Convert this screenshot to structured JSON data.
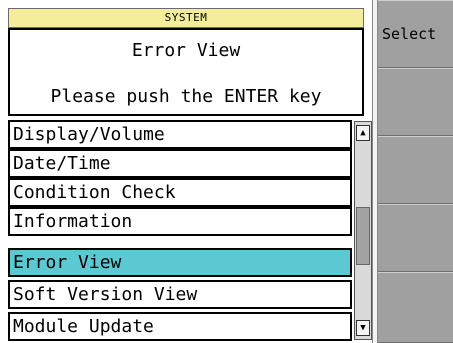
{
  "header": {
    "title": "SYSTEM"
  },
  "message": {
    "heading": "Error View",
    "instruction": "Please push the ENTER key"
  },
  "menu": {
    "items": [
      {
        "label": "Display/Volume",
        "selected": false
      },
      {
        "label": "Date/Time",
        "selected": false
      },
      {
        "label": "Condition Check",
        "selected": false
      },
      {
        "label": "Information",
        "selected": false
      },
      {
        "label": "Error View",
        "selected": true
      },
      {
        "label": "Soft Version View",
        "selected": false
      },
      {
        "label": "Module Update",
        "selected": false
      }
    ]
  },
  "scrollbar": {
    "up_glyph": "▲",
    "down_glyph": "▼"
  },
  "softkeys": [
    {
      "label": "Select"
    },
    {
      "label": ""
    },
    {
      "label": ""
    },
    {
      "label": ""
    },
    {
      "label": ""
    }
  ],
  "colors": {
    "title_bar": "#f4ee9c",
    "selected_item": "#5cc8d2",
    "softkey_panel": "#a0a0a0"
  }
}
